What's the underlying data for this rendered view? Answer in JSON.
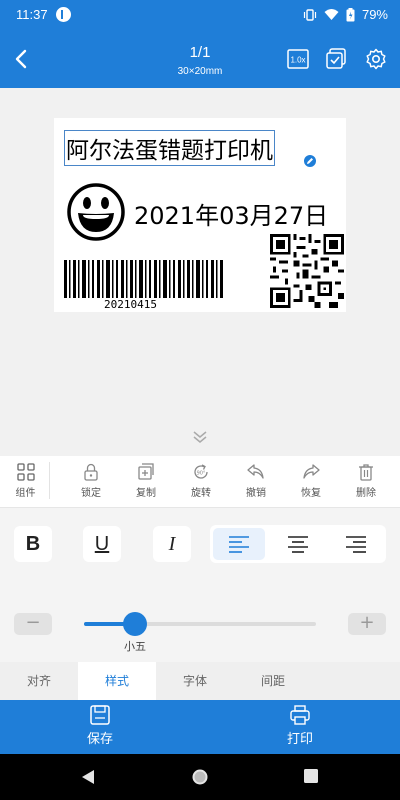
{
  "status_bar": {
    "time": "11:37",
    "battery": "79%",
    "icons": [
      "app-icon",
      "vibrate-icon",
      "wifi-icon",
      "battery-icon"
    ]
  },
  "header": {
    "title": "1/1",
    "subtitle": "30×20mm",
    "zoom_label": "1.0x",
    "icons": [
      "back-icon",
      "zoom-icon",
      "multi-select-icon",
      "settings-icon"
    ]
  },
  "label": {
    "text": "阿尔法蛋错题打印机",
    "date": "2021年03月27日",
    "barcode_number": "20210415"
  },
  "toolbar": {
    "items": [
      {
        "icon": "components-icon",
        "label": "组件"
      },
      {
        "icon": "lock-icon",
        "label": "锁定"
      },
      {
        "icon": "copy-icon",
        "label": "复制"
      },
      {
        "icon": "rotate-icon",
        "label": "旋转"
      },
      {
        "icon": "undo-icon",
        "label": "撤销"
      },
      {
        "icon": "redo-icon",
        "label": "恢复"
      },
      {
        "icon": "delete-icon",
        "label": "删除"
      }
    ]
  },
  "format": {
    "bold": "B",
    "underline": "U",
    "italic": "I",
    "alignment_selected": "left",
    "font_size_label": "小五",
    "font_size_fraction": 0.22,
    "minus": "−",
    "plus": "+"
  },
  "tabs": {
    "items": [
      "对齐",
      "样式",
      "字体",
      "间距"
    ],
    "active": "样式"
  },
  "actions": {
    "save": "保存",
    "print": "打印"
  },
  "colors": {
    "primary": "#1f7ed8"
  }
}
